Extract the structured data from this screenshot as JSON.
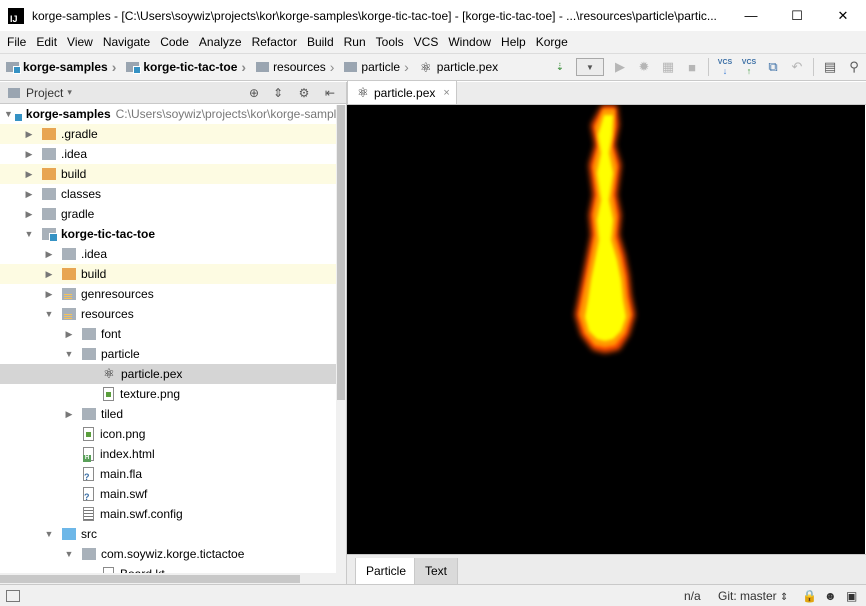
{
  "window": {
    "title": "korge-samples - [C:\\Users\\soywiz\\projects\\kor\\korge-samples\\korge-tic-tac-toe] - [korge-tic-tac-toe] - ...\\resources\\particle\\partic...",
    "app_icon": "IJ",
    "minimize": "—",
    "maximize": "☐",
    "close": "✕"
  },
  "menu": [
    "File",
    "Edit",
    "View",
    "Navigate",
    "Code",
    "Analyze",
    "Refactor",
    "Build",
    "Run",
    "Tools",
    "VCS",
    "Window",
    "Help",
    "Korge"
  ],
  "breadcrumb": [
    {
      "label": "korge-samples",
      "icon": "module-folder-icon",
      "bold": true
    },
    {
      "label": "korge-tic-tac-toe",
      "icon": "module-folder-icon",
      "bold": true
    },
    {
      "label": "resources",
      "icon": "resources-folder-icon",
      "bold": false
    },
    {
      "label": "particle",
      "icon": "folder-icon",
      "bold": false
    },
    {
      "label": "particle.pex",
      "icon": "particle-file-icon",
      "bold": false
    }
  ],
  "project_panel": {
    "title": "Project",
    "dropdown_arrow": "▾",
    "tree": [
      {
        "label": "korge-samples",
        "hint": "C:\\Users\\soywiz\\projects\\kor\\korge-samples",
        "arrow": "▼",
        "icon": "module",
        "bold": true
      },
      {
        "label": ".gradle",
        "arrow": "▶",
        "icon": "orange",
        "highlight": true
      },
      {
        "label": ".idea",
        "arrow": "▶",
        "icon": "grey"
      },
      {
        "label": "build",
        "arrow": "▶",
        "icon": "orange",
        "highlight": true
      },
      {
        "label": "classes",
        "arrow": "▶",
        "icon": "grey"
      },
      {
        "label": "gradle",
        "arrow": "▶",
        "icon": "grey"
      },
      {
        "label": "korge-tic-tac-toe",
        "arrow": "▼",
        "icon": "module",
        "bold": true
      },
      {
        "label": ".idea",
        "arrow": "▶",
        "icon": "grey"
      },
      {
        "label": "build",
        "arrow": "▶",
        "icon": "orange",
        "highlight": true
      },
      {
        "label": "genresources",
        "arrow": "▶",
        "icon": "res"
      },
      {
        "label": "resources",
        "arrow": "▼",
        "icon": "res"
      },
      {
        "label": "font",
        "arrow": "▶",
        "icon": "grey"
      },
      {
        "label": "particle",
        "arrow": "▼",
        "icon": "grey"
      },
      {
        "label": "particle.pex",
        "arrow": "",
        "icon": "atom",
        "selected": true
      },
      {
        "label": "texture.png",
        "arrow": "",
        "icon": "img"
      },
      {
        "label": "tiled",
        "arrow": "▶",
        "icon": "grey"
      },
      {
        "label": "icon.png",
        "arrow": "",
        "icon": "img"
      },
      {
        "label": "index.html",
        "arrow": "",
        "icon": "html"
      },
      {
        "label": "main.fla",
        "arrow": "",
        "icon": "q"
      },
      {
        "label": "main.swf",
        "arrow": "",
        "icon": "q"
      },
      {
        "label": "main.swf.config",
        "arrow": "",
        "icon": "cfg"
      },
      {
        "label": "src",
        "arrow": "▼",
        "icon": "blue"
      },
      {
        "label": "com.soywiz.korge.tictactoe",
        "arrow": "▼",
        "icon": "grey"
      },
      {
        "label": "Board.kt",
        "arrow": "",
        "icon": "kt"
      }
    ]
  },
  "editor": {
    "tab_label": "particle.pex",
    "tab_close": "×",
    "bottom_tabs": [
      "Particle",
      "Text"
    ]
  },
  "status": {
    "position": "n/a",
    "git": "Git: master",
    "git_arrows": "⇕"
  },
  "colors": {
    "selection": "#d5d5d5",
    "ignored_bg": "#fdfbe2",
    "canvas_bg": "#000000",
    "flame_core": "#ffff00",
    "flame_edge": "#ff5a00"
  }
}
